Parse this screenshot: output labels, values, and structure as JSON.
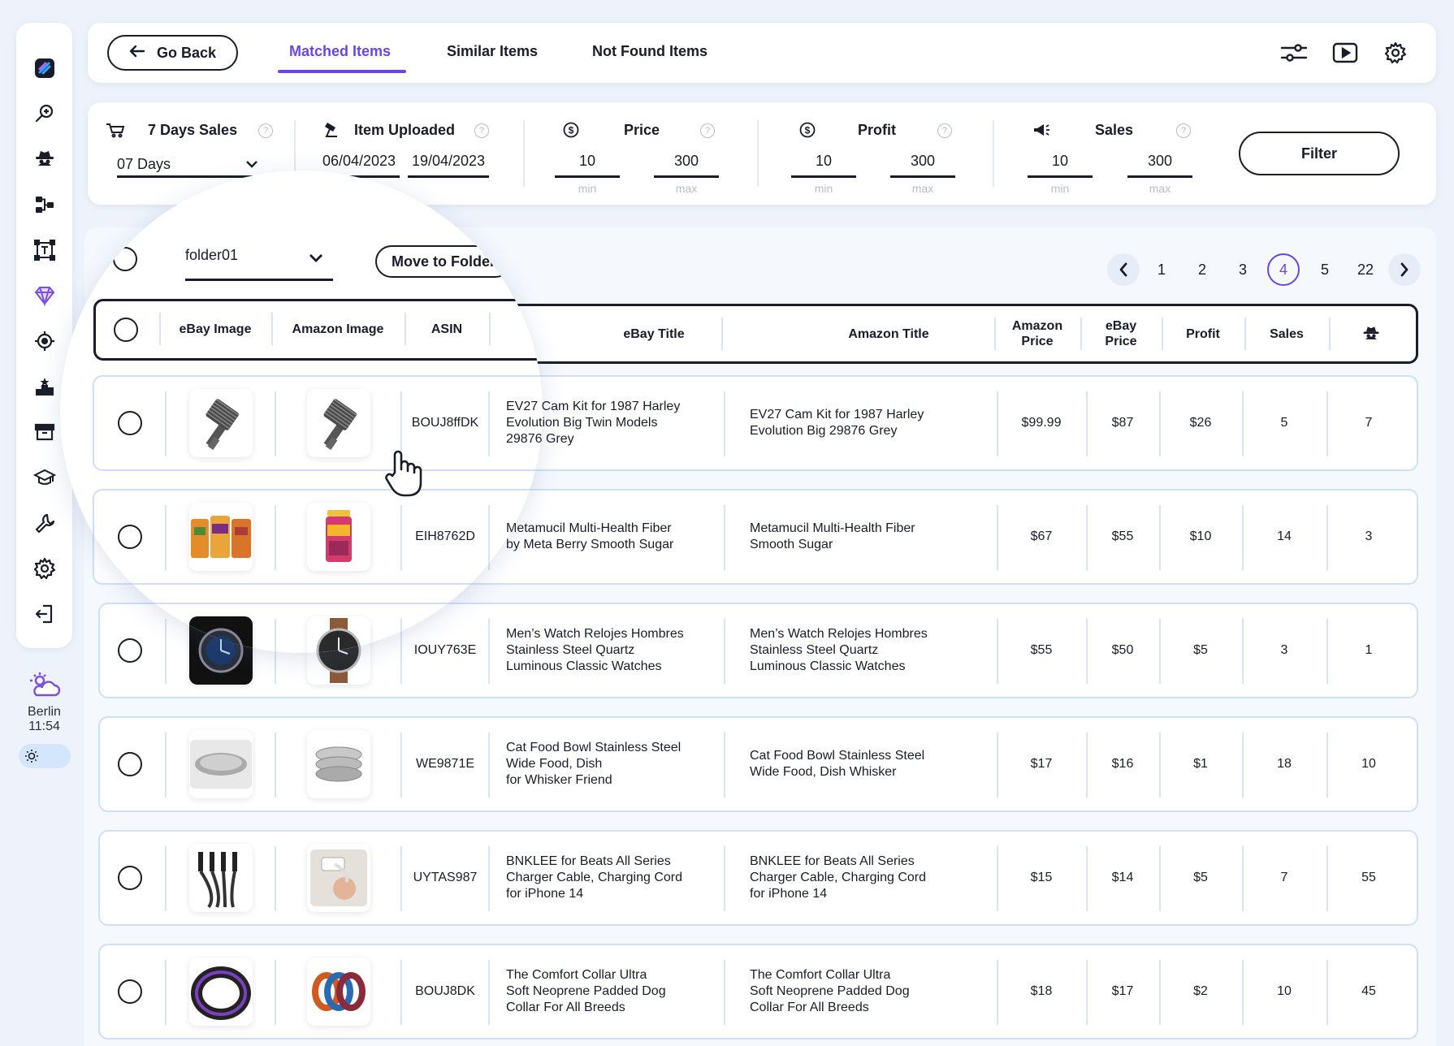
{
  "sidebar": {
    "items": [
      {
        "icon": "logo-icon"
      },
      {
        "icon": "search-plus-icon"
      },
      {
        "icon": "spy-icon"
      },
      {
        "icon": "flow-icon"
      },
      {
        "icon": "text-frame-icon"
      },
      {
        "icon": "diamond-icon"
      },
      {
        "icon": "target-icon"
      },
      {
        "icon": "rank-icon"
      },
      {
        "icon": "archive-icon"
      },
      {
        "icon": "graduation-cap-icon"
      },
      {
        "icon": "wrench-icon"
      },
      {
        "icon": "gear-icon"
      },
      {
        "icon": "logout-icon"
      }
    ],
    "weather": {
      "city": "Berlin",
      "time": "11:54"
    }
  },
  "topbar": {
    "back_label": "Go Back",
    "tabs": [
      "Matched Items",
      "Similar Items",
      "Not Found Items"
    ],
    "active_tab": "Matched Items"
  },
  "filters": {
    "days_sales": {
      "label": "7 Days Sales",
      "value": "07 Days"
    },
    "item_uploaded": {
      "label": "Item Uploaded",
      "from": "06/04/2023",
      "to": "19/04/2023"
    },
    "price": {
      "label": "Price",
      "min": "10",
      "max": "300",
      "min_label": "min",
      "max_label": "max"
    },
    "profit": {
      "label": "Profit",
      "min": "10",
      "max": "300",
      "min_label": "min",
      "max_label": "max"
    },
    "sales": {
      "label": "Sales",
      "min": "10",
      "max": "300",
      "min_label": "min",
      "max_label": "max"
    },
    "help": "?",
    "filter_label": "Filter"
  },
  "toolbar": {
    "folder": "folder01",
    "move_label": "Move to Folder"
  },
  "pagination": {
    "pages": [
      "1",
      "2",
      "3",
      "4",
      "5",
      "22"
    ],
    "current": "4"
  },
  "table": {
    "columns": {
      "ebay_image": "eBay Image",
      "amazon_image": "Amazon Image",
      "asin": "ASIN",
      "ebay_title": "eBay Title",
      "amazon_title": "Amazon Title",
      "amazon_price_1": "Amazon",
      "amazon_price_2": "Price",
      "ebay_price_1": "eBay",
      "ebay_price_2": "Price",
      "profit": "Profit",
      "sales": "Sales"
    },
    "rows": [
      {
        "asin": "BOUJ8ffDK",
        "ebay_title": [
          "EV27 Cam Kit for 1987 Harley",
          "Evolution Big Twin Models",
          "29876 Grey"
        ],
        "amazon_title": [
          "EV27 Cam Kit for 1987 Harley",
          "Evolution Big 29876 Grey"
        ],
        "amazon_price": "$99.99",
        "ebay_price": "$87",
        "profit": "$26",
        "sales": "5",
        "spy": "7",
        "img": "gear"
      },
      {
        "asin": "EIH8762D",
        "ebay_title": [
          "Metamucil Multi-Health Fiber",
          "by Meta Berry Smooth Sugar"
        ],
        "amazon_title": [
          "Metamucil Multi-Health Fiber",
          "Smooth Sugar"
        ],
        "amazon_price": "$67",
        "ebay_price": "$55",
        "profit": "$10",
        "sales": "14",
        "spy": "3",
        "img": "jar"
      },
      {
        "asin": "IOUY763E",
        "ebay_title": [
          "Men’s Watch Relojes Hombres",
          "Stainless Steel Quartz",
          "Luminous Classic Watches"
        ],
        "amazon_title": [
          "Men’s Watch Relojes Hombres",
          "Stainless Steel Quartz",
          "Luminous Classic Watches"
        ],
        "amazon_price": "$55",
        "ebay_price": "$50",
        "profit": "$5",
        "sales": "3",
        "spy": "1",
        "img": "watch"
      },
      {
        "asin": "WE9871E",
        "ebay_title": [
          "Cat Food Bowl Stainless Steel",
          "Wide Food, Dish",
          "for Whisker Friend"
        ],
        "amazon_title": [
          "Cat Food Bowl Stainless Steel",
          "Wide Food, Dish Whisker"
        ],
        "amazon_price": "$17",
        "ebay_price": "$16",
        "profit": "$1",
        "sales": "18",
        "spy": "10",
        "img": "bowl"
      },
      {
        "asin": "UYTAS987",
        "ebay_title": [
          "BNKLEE for Beats All Series",
          "Charger Cable, Charging Cord",
          "for iPhone 14"
        ],
        "amazon_title": [
          "BNKLEE for Beats All Series",
          "Charger Cable, Charging Cord",
          "for iPhone 14"
        ],
        "amazon_price": "$15",
        "ebay_price": "$14",
        "profit": "$5",
        "sales": "7",
        "spy": "55",
        "img": "cable"
      },
      {
        "asin": "BOUJ8DK",
        "ebay_title": [
          "The Comfort Collar Ultra",
          "Soft Neoprene Padded Dog",
          "Collar For All Breeds"
        ],
        "amazon_title": [
          "The Comfort Collar Ultra",
          "Soft Neoprene Padded Dog",
          "Collar For All Breeds"
        ],
        "amazon_price": "$18",
        "ebay_price": "$17",
        "profit": "$2",
        "sales": "10",
        "spy": "45",
        "img": "collar"
      }
    ]
  },
  "colors": {
    "accent": "#6a46e0",
    "text": "#1a1d29",
    "row_border": "#cfe0f5",
    "bg": "#eef3fb"
  }
}
